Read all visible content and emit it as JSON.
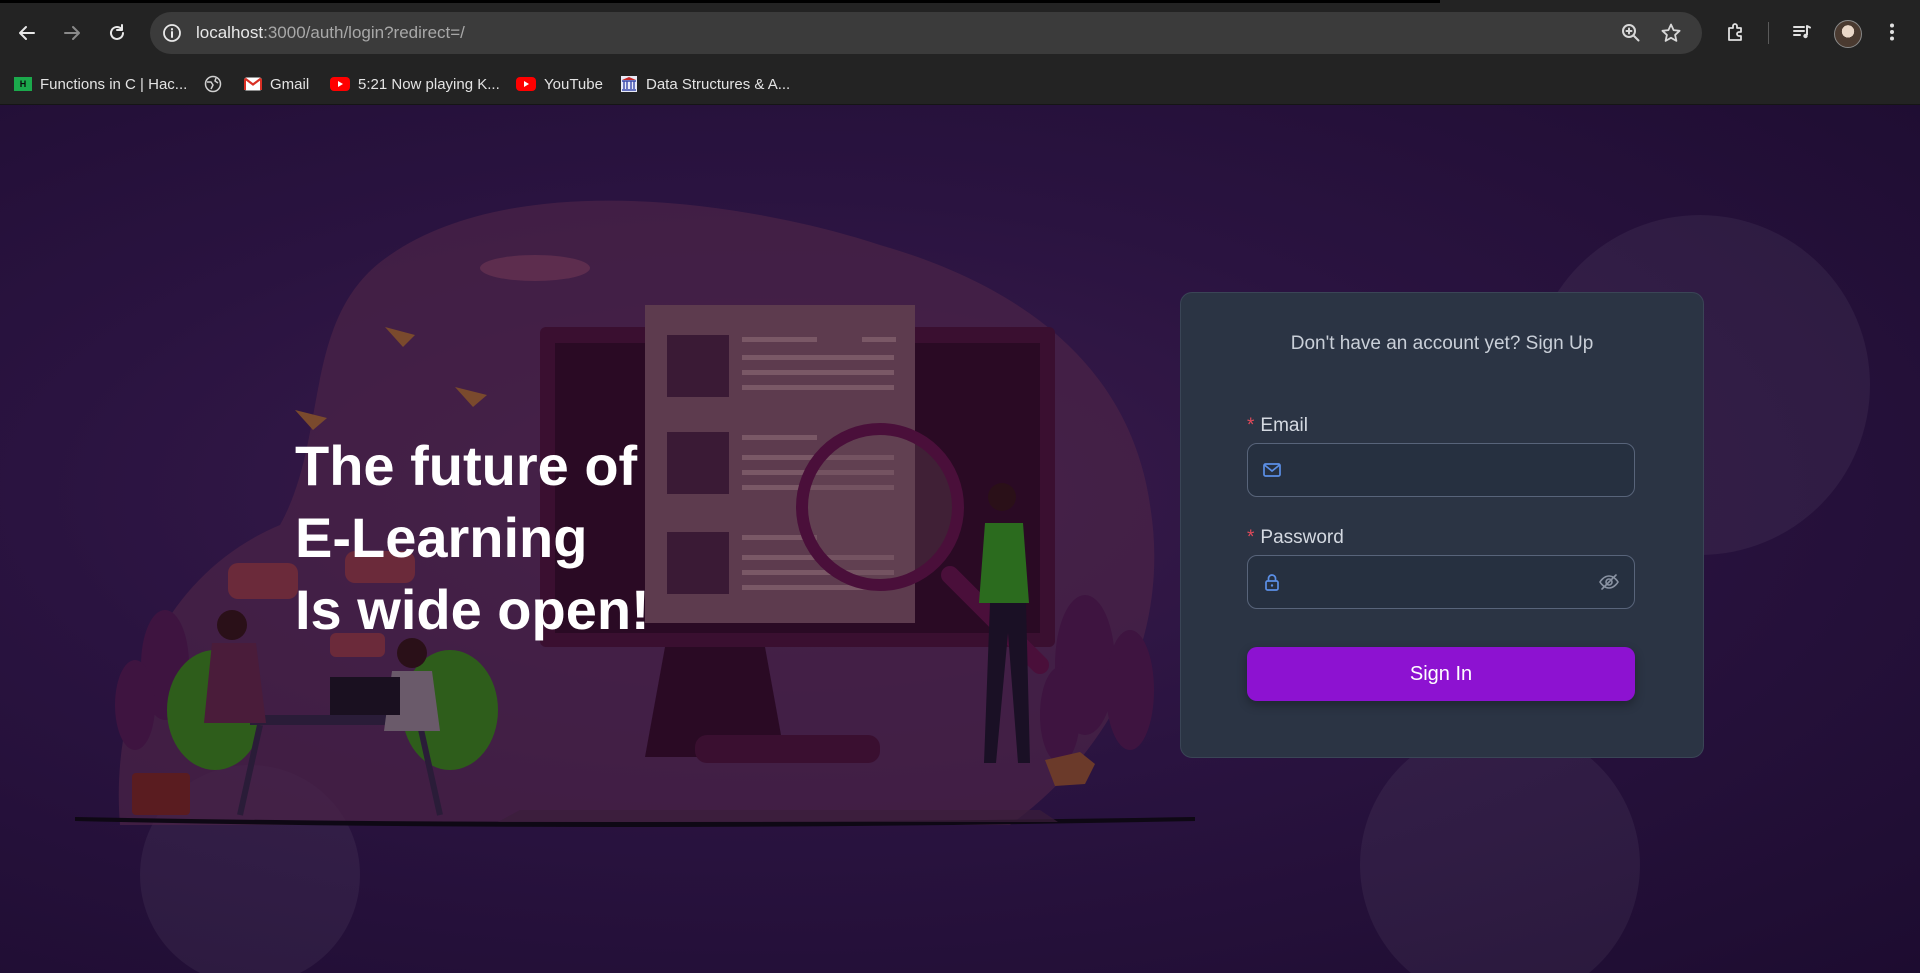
{
  "browser": {
    "url_host": "localhost",
    "url_path": ":3000/auth/login?redirect=/",
    "bookmarks": [
      {
        "label": "Functions in C | Hac...",
        "icon": "hackerrank-icon"
      },
      {
        "label": "",
        "icon": "globe-icon"
      },
      {
        "label": "Gmail",
        "icon": "gmail-icon"
      },
      {
        "label": "5:21 Now playing K...",
        "icon": "youtube-icon"
      },
      {
        "label": "YouTube",
        "icon": "youtube-icon"
      },
      {
        "label": "Data Structures & A...",
        "icon": "university-icon"
      }
    ],
    "hackerrank_glyph": "H"
  },
  "hero": {
    "line1": "The future of",
    "line2": "E-Learning",
    "line3": "Is wide open!"
  },
  "login": {
    "signup_prompt": "Don't have an account yet? Sign Up",
    "required_mark": "*",
    "email_label": "Email",
    "email_value": "",
    "password_label": "Password",
    "password_value": "",
    "signin_label": "Sign In"
  },
  "colors": {
    "accent": "#8d12d1",
    "card": "#2b3444",
    "background": "#2a1340",
    "required": "#e04a5a"
  }
}
